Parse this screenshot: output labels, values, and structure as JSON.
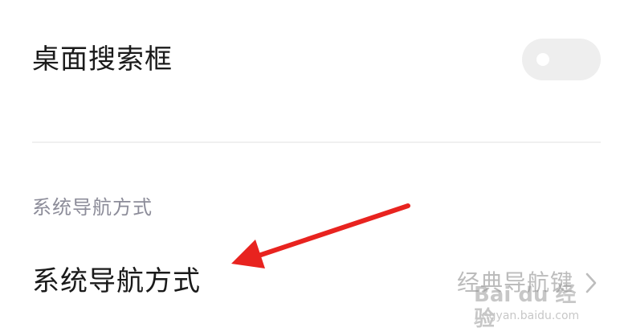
{
  "settings": {
    "desktop_search": {
      "label": "桌面搜索框",
      "toggle_state": "off"
    },
    "section_header": "系统导航方式",
    "nav_mode": {
      "label": "系统导航方式",
      "value": "经典导航键"
    }
  },
  "annotation": {
    "arrow_color": "#e8231f"
  },
  "watermark": {
    "logo_text": "Bai du 经验",
    "url_text": "jingyan.baidu.com"
  },
  "icons": {
    "chevron": "chevron-right-icon",
    "arrow": "red-arrow-annotation"
  }
}
